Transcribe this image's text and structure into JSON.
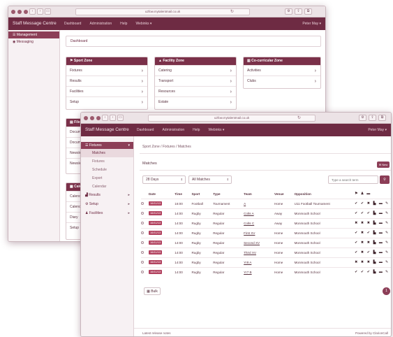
{
  "back": {
    "url": "u2fow.mytalentmail.co.uk",
    "brand": "Staff Message Centre",
    "menu": [
      "Dashboard",
      "Administration",
      "Help",
      "Webinks ▾"
    ],
    "user": "Peter May ▾",
    "side": [
      "Management",
      "Messaging"
    ],
    "breadcrumb": "Dashboard",
    "panels": [
      {
        "title": "Sport Zone",
        "icon": "⚑",
        "items": [
          "Fixtures",
          "Results",
          "Facilities",
          "Setup"
        ]
      },
      {
        "title": "Facility Zone",
        "icon": "▲",
        "items": [
          "Catering",
          "Transport",
          "Resources",
          "Estate"
        ]
      },
      {
        "title": "Co-curricular Zone",
        "icon": "▥",
        "items": [
          "Activities",
          "Clubs"
        ]
      }
    ],
    "file_panel": {
      "title": "File",
      "items": [
        "Docum",
        "Docum",
        "Newsle",
        "Newsle"
      ]
    },
    "cal_panel": {
      "title": "Cale",
      "items": [
        "Calend",
        "Calend",
        "Diary",
        "Setup"
      ]
    }
  },
  "front": {
    "url": "u2fow.mytalentmail.co.uk",
    "brand": "Staff Message Centre",
    "menu": [
      "Dashboard",
      "Administration",
      "Help",
      "Webinks ▾"
    ],
    "user": "Peter May ▾",
    "side_top": "Fixtures",
    "side_sub": [
      "Matches",
      "Fixtures",
      "Schedule",
      "Export",
      "Calendar"
    ],
    "side_rest": [
      "Results",
      "Setup",
      "Facilities"
    ],
    "breadcrumb": "Sport Zone  /  Fixtures  /  Matches",
    "section_title": "Matches",
    "new_label": "⊕ New",
    "filter_days": "28 Days",
    "filter_matches": "All Matches",
    "search_placeholder": "Type a search term",
    "headers": [
      "Date",
      "Time",
      "Sport",
      "Type",
      "Team",
      "Venue",
      "Opposition"
    ],
    "rows": [
      {
        "date": "16/11/13",
        "time": "16:00",
        "sport": "Football",
        "type": "Tournament",
        "team": "A",
        "venue": "Home",
        "opp": "U11 Football Tournament",
        "s": [
          "✔",
          "✔",
          "✖"
        ]
      },
      {
        "date": "16/11/13",
        "time": "14:00",
        "sport": "Rugby",
        "type": "Regular",
        "team": "Colts A",
        "venue": "Away",
        "opp": "Monmouth School",
        "s": [
          "✔",
          "✔",
          "✔"
        ]
      },
      {
        "date": "16/11/13",
        "time": "14:00",
        "sport": "Rugby",
        "type": "Regular",
        "team": "Colts C",
        "venue": "Away",
        "opp": "Monmouth School",
        "s": [
          "✖",
          "✖",
          "✖"
        ]
      },
      {
        "date": "16/11/13",
        "time": "14:00",
        "sport": "Rugby",
        "type": "Regular",
        "team": "First XV",
        "venue": "Home",
        "opp": "Monmouth School",
        "s": [
          "✔",
          "✖",
          "✔"
        ]
      },
      {
        "date": "16/11/13",
        "time": "14:00",
        "sport": "Rugby",
        "type": "Regular",
        "team": "Second XV",
        "venue": "Home",
        "opp": "Monmouth School",
        "s": [
          "✔",
          "✖",
          "✖"
        ]
      },
      {
        "date": "16/11/13",
        "time": "14:00",
        "sport": "Rugby",
        "type": "Regular",
        "team": "Third XV",
        "venue": "Home",
        "opp": "Monmouth School",
        "s": [
          "✔",
          "✖",
          "✔"
        ]
      },
      {
        "date": "16/11/13",
        "time": "14:00",
        "sport": "Rugby",
        "type": "Regular",
        "team": "Yr8 A",
        "venue": "Home",
        "opp": "Monmouth School",
        "s": [
          "✖",
          "✖",
          "✖"
        ]
      },
      {
        "date": "16/11/13",
        "time": "14:00",
        "sport": "Rugby",
        "type": "Regular",
        "team": "Yr7 B",
        "venue": "Home",
        "opp": "Monmouth School",
        "s": [
          "✔",
          "✔",
          "✔"
        ]
      }
    ],
    "bulk_label": "Bulk",
    "page_num": "1",
    "footer_left": "Latest release notes",
    "footer_right": "Powered by ClarionCall"
  }
}
